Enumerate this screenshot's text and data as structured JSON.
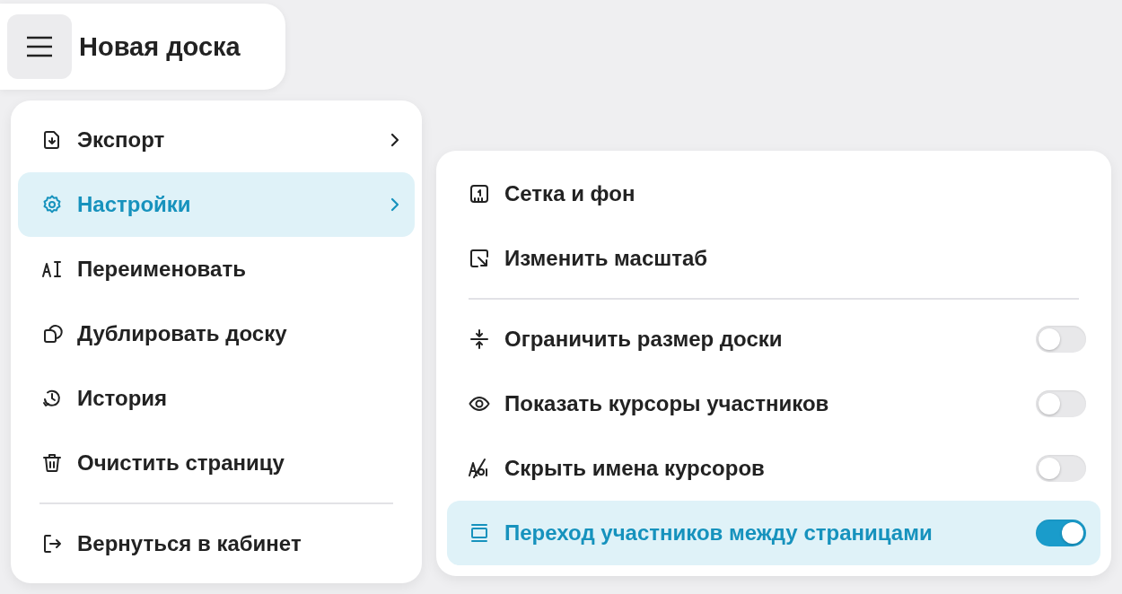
{
  "header": {
    "title": "Новая доска"
  },
  "main_menu": {
    "groups": [
      [
        {
          "label": "Экспорт",
          "kind": "submenu",
          "selected": false
        },
        {
          "label": "Настройки",
          "kind": "submenu",
          "selected": true
        },
        {
          "label": "Переименовать",
          "kind": "action",
          "selected": false
        },
        {
          "label": "Дублировать доску",
          "kind": "action",
          "selected": false
        },
        {
          "label": "История",
          "kind": "action",
          "selected": false
        },
        {
          "label": "Очистить страницу",
          "kind": "action",
          "selected": false
        }
      ],
      [
        {
          "label": "Вернуться в кабинет",
          "kind": "action",
          "selected": false
        }
      ]
    ]
  },
  "settings_menu": {
    "groups": [
      [
        {
          "label": "Сетка и фон",
          "kind": "action",
          "selected": false
        },
        {
          "label": "Изменить масштаб",
          "kind": "action",
          "selected": false
        }
      ],
      [
        {
          "label": "Ограничить размер доски",
          "kind": "toggle",
          "on": false,
          "selected": false
        },
        {
          "label": "Показать курсоры участников",
          "kind": "toggle",
          "on": false,
          "selected": false
        },
        {
          "label": "Скрыть имена курсоров",
          "kind": "toggle",
          "on": false,
          "selected": false
        },
        {
          "label": "Переход участников между страницами",
          "kind": "toggle",
          "on": true,
          "selected": true
        }
      ]
    ]
  }
}
